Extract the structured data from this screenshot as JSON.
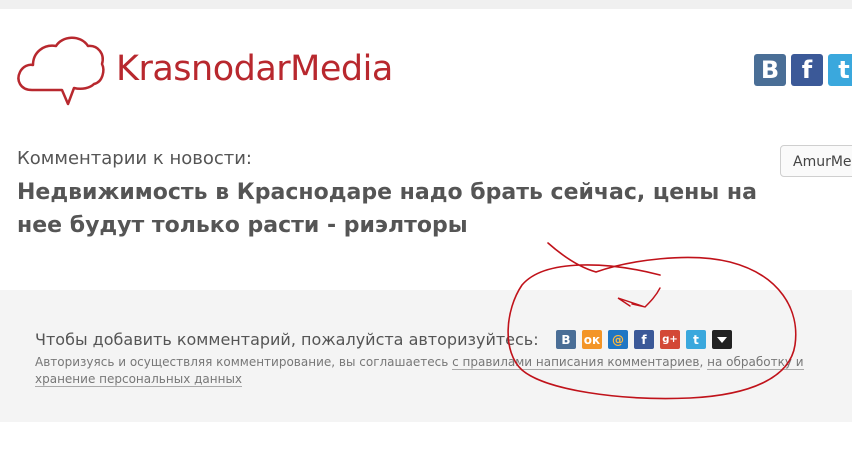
{
  "header": {
    "brand": "KrasnodarMedia",
    "social": [
      {
        "icon": "vk-icon",
        "glyph": "B"
      },
      {
        "icon": "facebook-icon",
        "glyph": "f"
      },
      {
        "icon": "twitter-icon",
        "glyph": "t"
      }
    ]
  },
  "news": {
    "label": "Комментарии к новости:",
    "title": "Недвижимость в Краснодаре надо брать сейчас, цены на нее будут только расти - риэлторы",
    "site_button": "AmurMedia"
  },
  "comments": {
    "auth_prompt": "Чтобы добавить комментарий, пожалуйста авторизуйтесь:",
    "auth_icons": [
      "vk",
      "odnoklassniki",
      "mail-ru",
      "facebook",
      "google-plus",
      "twitter",
      "more"
    ],
    "agree_text": "Авторизуясь и осуществляя комментирование, вы соглашаетесь ",
    "agree_link1": "с правилами написания комментариев",
    "agree_sep": ", ",
    "agree_link2": "на обработку и хранение персональных данных"
  },
  "colors": {
    "brand": "#b8282e",
    "annotation": "#c0121a"
  }
}
